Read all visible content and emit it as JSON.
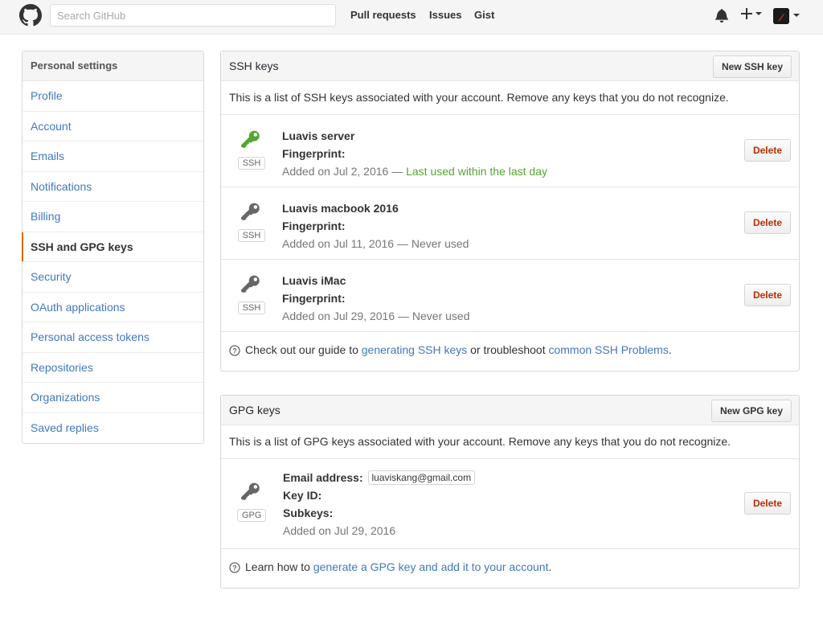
{
  "header": {
    "search_placeholder": "Search GitHub",
    "nav": [
      "Pull requests",
      "Issues",
      "Gist"
    ],
    "icons": [
      "github-logo-icon",
      "bell-icon",
      "plus-icon",
      "avatar"
    ]
  },
  "sidebar": {
    "heading": "Personal settings",
    "items": [
      {
        "label": "Profile"
      },
      {
        "label": "Account"
      },
      {
        "label": "Emails"
      },
      {
        "label": "Notifications"
      },
      {
        "label": "Billing"
      },
      {
        "label": "SSH and GPG keys",
        "selected": true
      },
      {
        "label": "Security"
      },
      {
        "label": "OAuth applications"
      },
      {
        "label": "Personal access tokens"
      },
      {
        "label": "Repositories"
      },
      {
        "label": "Organizations"
      },
      {
        "label": "Saved replies"
      }
    ]
  },
  "ssh": {
    "title": "SSH keys",
    "new_button": "New SSH key",
    "description": "This is a list of SSH keys associated with your account. Remove any keys that you do not recognize.",
    "keys": [
      {
        "title": "Luavis server",
        "type": "SSH",
        "fingerprint_label": "Fingerprint:",
        "added": "Added on Jul 2, 2016 — ",
        "usage": "Last used within the last day",
        "active": true,
        "delete": "Delete"
      },
      {
        "title": "Luavis macbook 2016",
        "type": "SSH",
        "fingerprint_label": "Fingerprint:",
        "added": "Added on Jul 11, 2016 — ",
        "usage": "Never used",
        "active": false,
        "delete": "Delete"
      },
      {
        "title": "Luavis iMac",
        "type": "SSH",
        "fingerprint_label": "Fingerprint:",
        "added": "Added on Jul 29, 2016 — ",
        "usage": "Never used",
        "active": false,
        "delete": "Delete"
      }
    ],
    "footer": {
      "prefix": "Check out our guide to ",
      "link1": "generating SSH keys",
      "middle": " or troubleshoot ",
      "link2": "common SSH Problems",
      "suffix": "."
    }
  },
  "gpg": {
    "title": "GPG keys",
    "new_button": "New GPG key",
    "description": "This is a list of GPG keys associated with your account. Remove any keys that you do not recognize.",
    "key": {
      "type": "GPG",
      "email_label": "Email address:",
      "email": "luaviskang@gmail.com",
      "key_id_label": "Key ID:",
      "subkeys_label": "Subkeys:",
      "added": "Added on Jul 29, 2016",
      "delete": "Delete"
    },
    "footer": {
      "prefix": "Learn how to ",
      "link": "generate a GPG key and add it to your account",
      "suffix": "."
    }
  },
  "colors": {
    "link": "#4078c0",
    "selected_bar": "#d26911",
    "active_key": "#55a532",
    "inactive_key": "#666666",
    "delete": "#bd2c00"
  }
}
